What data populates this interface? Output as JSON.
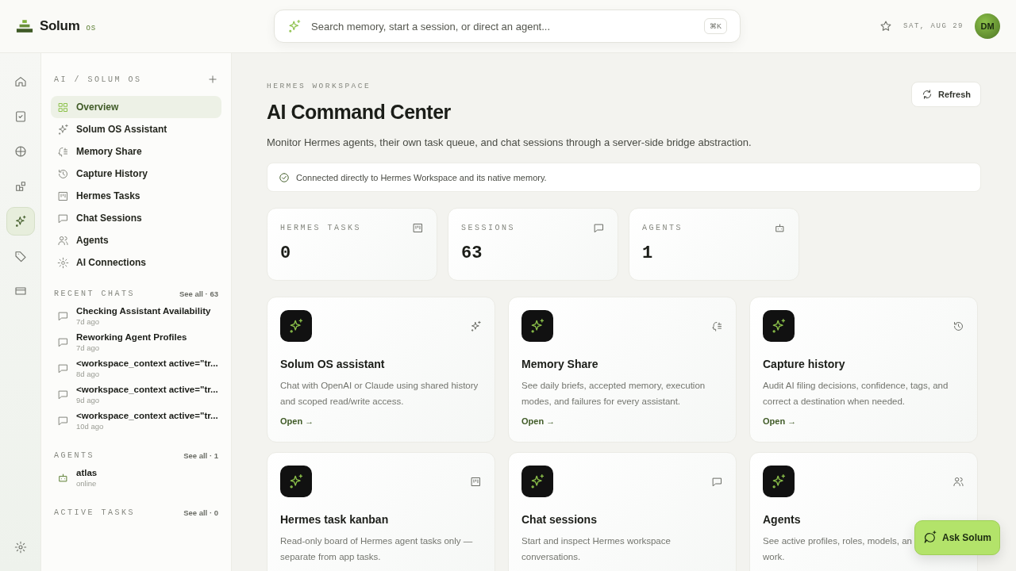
{
  "brand": {
    "name": "Solum",
    "suffix": "OS"
  },
  "search": {
    "placeholder": "Search memory, start a session, or direct an agent...",
    "shortcut": "⌘K"
  },
  "header": {
    "date": "SAT, AUG 29",
    "avatar": "DM"
  },
  "rail": {
    "items": [
      {
        "selected": false
      },
      {
        "selected": false
      },
      {
        "selected": false
      },
      {
        "selected": false
      },
      {
        "selected": true
      },
      {
        "selected": false
      },
      {
        "selected": false
      }
    ]
  },
  "sidebar": {
    "breadcrumb": "AI / SOLUM OS",
    "items": [
      {
        "label": "Overview",
        "selected": true
      },
      {
        "label": "Solum OS Assistant",
        "selected": false
      },
      {
        "label": "Memory Share",
        "selected": false
      },
      {
        "label": "Capture History",
        "selected": false
      },
      {
        "label": "Hermes Tasks",
        "selected": false
      },
      {
        "label": "Chat Sessions",
        "selected": false
      },
      {
        "label": "Agents",
        "selected": false
      },
      {
        "label": "AI Connections",
        "selected": false
      }
    ],
    "recent_chats": {
      "title": "RECENT CHATS",
      "link": "See all · 63",
      "items": [
        {
          "title": "Checking Assistant Availability",
          "time": "7d ago"
        },
        {
          "title": "Reworking Agent Profiles",
          "time": "7d ago"
        },
        {
          "title": "<workspace_context active=\"tr...",
          "time": "8d ago"
        },
        {
          "title": "<workspace_context active=\"tr...",
          "time": "9d ago"
        },
        {
          "title": "<workspace_context active=\"tr...",
          "time": "10d ago"
        }
      ]
    },
    "agents": {
      "title": "AGENTS",
      "link": "See all · 1",
      "items": [
        {
          "name": "atlas",
          "status": "online"
        }
      ]
    },
    "active_tasks": {
      "title": "ACTIVE TASKS",
      "link": "See all · 0"
    }
  },
  "main": {
    "eyebrow": "HERMES WORKSPACE",
    "title": "AI Command Center",
    "refresh": "Refresh",
    "subtitle": "Monitor Hermes agents, their own task queue, and chat sessions through a server-side bridge abstraction.",
    "notice": "Connected directly to Hermes Workspace and its native memory.",
    "stats": [
      {
        "label": "HERMES TASKS",
        "value": "0"
      },
      {
        "label": "SESSIONS",
        "value": "63"
      },
      {
        "label": "AGENTS",
        "value": "1"
      }
    ],
    "cards": [
      {
        "title": "Solum OS assistant",
        "lines": [
          "Chat with OpenAI or Claude using shared history",
          "and scoped read/write access."
        ],
        "link": "Open →"
      },
      {
        "title": "Memory Share",
        "lines": [
          "See daily briefs, accepted memory, execution",
          "modes, and failures for every assistant."
        ],
        "link": "Open →"
      },
      {
        "title": "Capture history",
        "lines": [
          "Audit AI filing decisions, confidence, tags, and",
          "correct a destination when needed."
        ],
        "link": "Open →"
      },
      {
        "title": "Hermes task kanban",
        "lines": [
          "Read-only board of Hermes agent tasks only —",
          "separate from app tasks."
        ]
      },
      {
        "title": "Chat sessions",
        "lines": [
          "Start and inspect Hermes workspace",
          "conversations."
        ]
      },
      {
        "title": "Agents",
        "lines": [
          "See active profiles, roles, models, an",
          "work."
        ]
      }
    ]
  },
  "ask_button": "Ask Solum"
}
